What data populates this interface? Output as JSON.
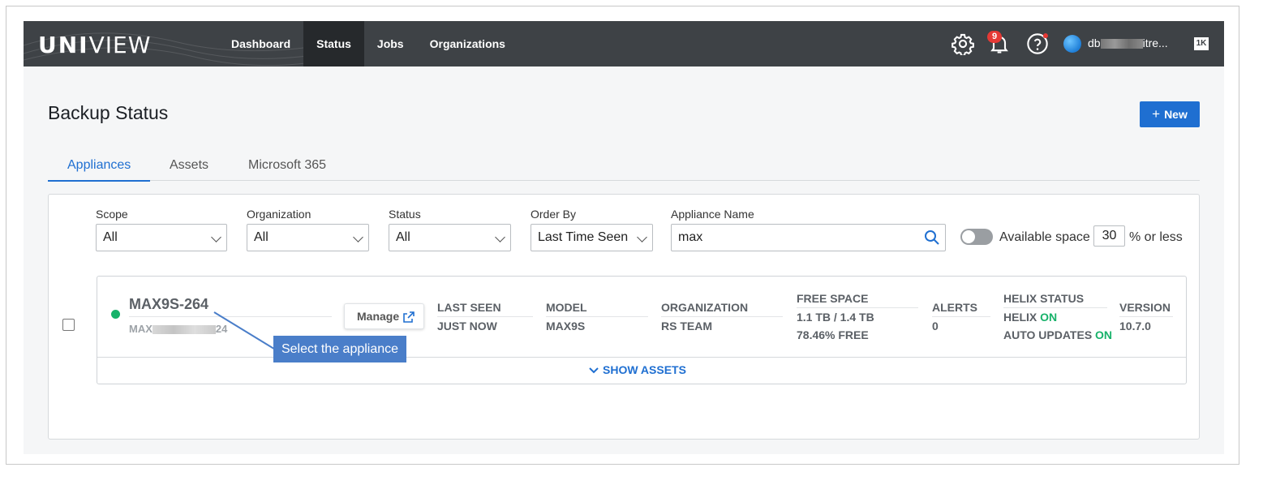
{
  "brand": {
    "bold": "UNI",
    "thin": "VIEW"
  },
  "nav": [
    {
      "label": "Dashboard"
    },
    {
      "label": "Status",
      "active": true
    },
    {
      "label": "Jobs"
    },
    {
      "label": "Organizations"
    }
  ],
  "topbar": {
    "notification_count": "9",
    "user_prefix": "db",
    "user_suffix": "itre...",
    "app_switch": "1K"
  },
  "page": {
    "title": "Backup Status",
    "new_label": "New"
  },
  "tabs": [
    {
      "label": "Appliances",
      "active": true
    },
    {
      "label": "Assets"
    },
    {
      "label": "Microsoft 365"
    }
  ],
  "filters": {
    "scope": {
      "label": "Scope",
      "value": "All"
    },
    "organization": {
      "label": "Organization",
      "value": "All"
    },
    "status": {
      "label": "Status",
      "value": "All"
    },
    "order_by": {
      "label": "Order By",
      "value": "Last Time Seen"
    },
    "appliance_name": {
      "label": "Appliance Name",
      "value": "max"
    },
    "available_space": {
      "label": "Available space",
      "value": "30",
      "suffix": "% or less",
      "enabled": false
    }
  },
  "appliance": {
    "name": "MAX9S-264",
    "serial_prefix": "MAX",
    "serial_suffix": "24",
    "manage_label": "Manage",
    "status_color": "#17b26a",
    "last_seen": {
      "label": "LAST SEEN",
      "value": "JUST NOW"
    },
    "model": {
      "label": "MODEL",
      "value": "MAX9S"
    },
    "organization": {
      "label": "ORGANIZATION",
      "value": "RS TEAM"
    },
    "free_space": {
      "label": "FREE SPACE",
      "value": "1.1 TB / 1.4 TB",
      "percent": "78.46% FREE"
    },
    "alerts": {
      "label": "ALERTS",
      "value": "0"
    },
    "helix": {
      "label": "HELIX STATUS",
      "helix_label": "HELIX",
      "helix_value": "ON",
      "auto_label": "AUTO UPDATES",
      "auto_value": "ON"
    },
    "version": {
      "label": "VERSION",
      "value": "10.7.0"
    },
    "show_assets_label": "SHOW ASSETS"
  },
  "annotation": {
    "text": "Select the appliance"
  },
  "colors": {
    "accent": "#1f6fd1",
    "topbar": "#3e4246",
    "online": "#17b26a",
    "badge": "#e53935",
    "callout": "#4a7ec9"
  }
}
